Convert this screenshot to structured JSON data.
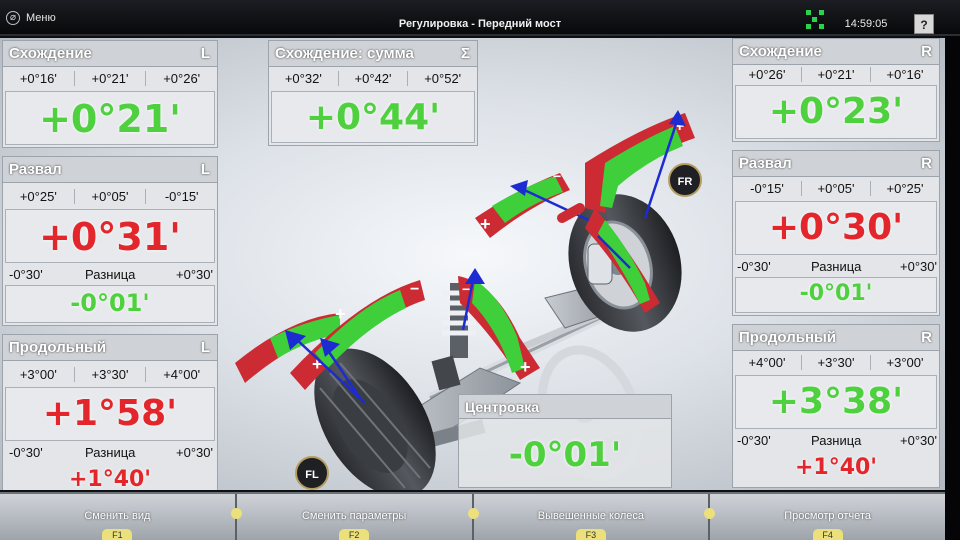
{
  "titlebar": {
    "menu_label": "Меню",
    "title": "Регулировка - Передний мост",
    "clock": "14:59:05",
    "help_label": "?"
  },
  "left": {
    "toe": {
      "title": "Схождение",
      "side": "L",
      "values": [
        "+0°16'",
        "+0°21'",
        "+0°26'"
      ],
      "current": "+0°21'",
      "current_color": "green"
    },
    "camber": {
      "title": "Развал",
      "side": "L",
      "values": [
        "+0°25'",
        "+0°05'",
        "-0°15'"
      ],
      "current": "+0°31'",
      "current_color": "red",
      "diff_min": "-0°30'",
      "diff_label": "Разница",
      "diff_max": "+0°30'",
      "diff_value": "-0°01'"
    },
    "caster": {
      "title": "Продольный",
      "side": "L",
      "values": [
        "+3°00'",
        "+3°30'",
        "+4°00'"
      ],
      "current": "+1°58'",
      "current_color": "red",
      "diff_min": "-0°30'",
      "diff_label": "Разница",
      "diff_max": "+0°30'",
      "diff_value": "+1°40'"
    }
  },
  "total_toe": {
    "title": "Схождение: сумма",
    "symbol": "Σ",
    "values": [
      "+0°32'",
      "+0°42'",
      "+0°52'"
    ],
    "current": "+0°44'",
    "current_color": "green"
  },
  "right": {
    "toe": {
      "title": "Схождение",
      "side": "R",
      "values": [
        "+0°26'",
        "+0°21'",
        "+0°16'"
      ],
      "current": "+0°23'",
      "current_color": "green"
    },
    "camber": {
      "title": "Развал",
      "side": "R",
      "values": [
        "-0°15'",
        "+0°05'",
        "+0°25'"
      ],
      "current": "+0°30'",
      "current_color": "red",
      "diff_min": "-0°30'",
      "diff_label": "Разница",
      "diff_max": "+0°30'",
      "diff_value": "-0°01'"
    },
    "caster": {
      "title": "Продольный",
      "side": "R",
      "values": [
        "+4°00'",
        "+3°30'",
        "+3°00'"
      ],
      "current": "+3°38'",
      "current_color": "green",
      "diff_min": "-0°30'",
      "diff_label": "Разница",
      "diff_max": "+0°30'",
      "diff_value": "+1°40'"
    }
  },
  "centering": {
    "title": "Центровка",
    "value": "-0°01'"
  },
  "wheel_badges": {
    "front_left": "FL",
    "front_right": "FR"
  },
  "function_bar": [
    {
      "label": "Сменить вид",
      "key": "F1"
    },
    {
      "label": "Сменить параметры",
      "key": "F2"
    },
    {
      "label": "Вывешенные колеса",
      "key": "F3"
    },
    {
      "label": "Просмотр отчета",
      "key": "F4"
    }
  ],
  "colors": {
    "in_range": "#4fd13f",
    "out_of_range": "#e3262c",
    "highlight": "#ece07a"
  },
  "icons": {
    "menu": "menu-logo-icon",
    "lift": "lift-status-icon",
    "help": "help-icon"
  }
}
